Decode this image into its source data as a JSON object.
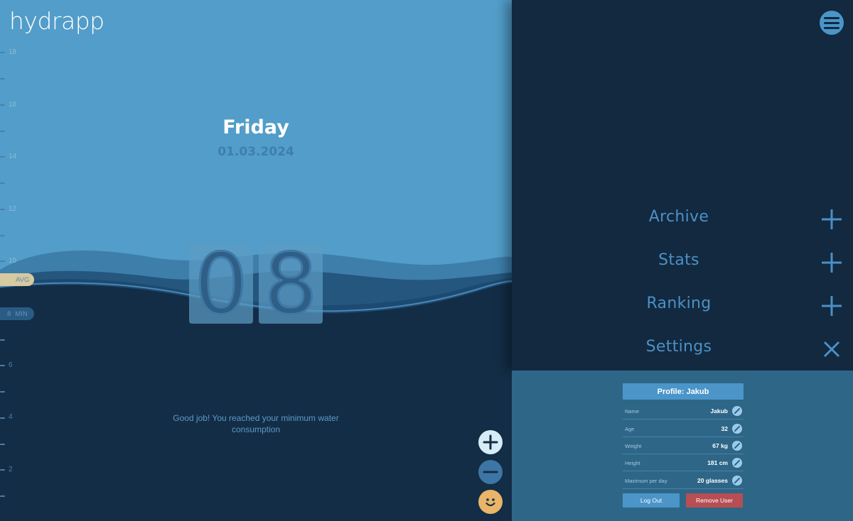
{
  "app": {
    "logo_text_start": "hydra",
    "logo_text_end": "pp",
    "scale_labels": [
      "18",
      "16",
      "14",
      "12",
      "10",
      "8",
      "6",
      "4",
      "2"
    ],
    "avg_label": "AVG",
    "min_value": "8",
    "min_label": "MIN",
    "day_name": "Friday",
    "date": "01.03.2024",
    "counter_digits": [
      "0",
      "8"
    ],
    "message": "Good job! You reached your minimum water consumption",
    "buttons": {
      "add": "plus-icon",
      "remove": "minus-icon",
      "mood": "smiley-icon"
    }
  },
  "menu": {
    "items": [
      {
        "label": "Archive",
        "toggle_icon": "plus-icon"
      },
      {
        "label": "Stats",
        "toggle_icon": "plus-icon"
      },
      {
        "label": "Ranking",
        "toggle_icon": "plus-icon"
      },
      {
        "label": "Settings",
        "toggle_icon": "close-icon"
      }
    ]
  },
  "settings": {
    "profile_title": "Profile: Jakub",
    "fields": [
      {
        "label": "Name",
        "value": "Jakub"
      },
      {
        "label": "Age",
        "value": "32"
      },
      {
        "label": "Weight",
        "value": "67 kg"
      },
      {
        "label": "Height",
        "value": "181 cm"
      },
      {
        "label": "Maximum per day",
        "value": "20 glasses"
      }
    ],
    "logout_label": "Log Out",
    "remove_user_label": "Remove User"
  },
  "colors": {
    "sky": "#529dc9",
    "deep_water": "#132d46",
    "menu_bg": "#12293f",
    "accent_blue": "#4b95c9",
    "danger": "#b74e54",
    "mood": "#e9b569"
  }
}
